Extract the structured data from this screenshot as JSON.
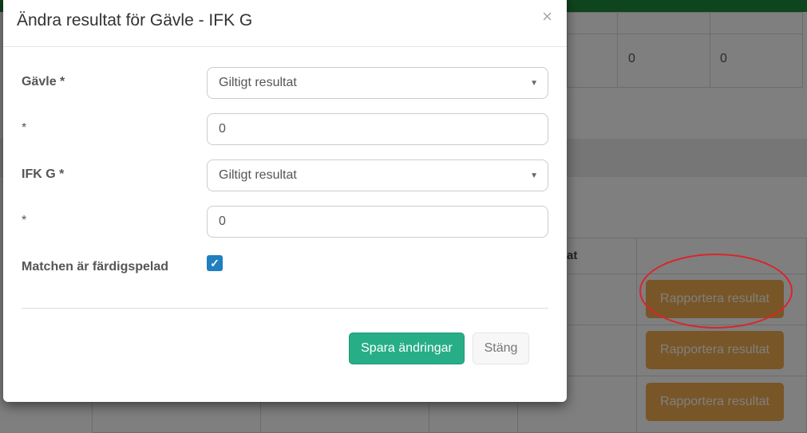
{
  "modal": {
    "title": "Ändra resultat för Gävle - IFK G",
    "close_symbol": "×",
    "home": {
      "label": "Gävle *",
      "status_value": "Giltigt resultat",
      "score_label": "*",
      "score_value": "0"
    },
    "away": {
      "label": "IFK G *",
      "status_value": "Giltigt resultat",
      "score_label": "*",
      "score_value": "0"
    },
    "finished": {
      "label": "Matchen är färdigspelad",
      "checked": true
    },
    "buttons": {
      "save": "Spara ändringar",
      "close": "Stäng"
    }
  },
  "background": {
    "row_values": [
      "0",
      "0"
    ],
    "column_header_fragment": "at",
    "report_buttons": [
      "Rapportera resultat",
      "Rapportera resultat",
      "Rapportera resultat"
    ],
    "annotation_color": "#d9262b"
  },
  "icons": {
    "select_arrow": "chevron-down-icon",
    "checkbox": "checkmark-icon",
    "close": "close-icon"
  },
  "colors": {
    "primary": "#27ae86",
    "warning": "#f0ad4e",
    "checkbox": "#1f7fbf",
    "topbar": "#1f8a3c"
  }
}
